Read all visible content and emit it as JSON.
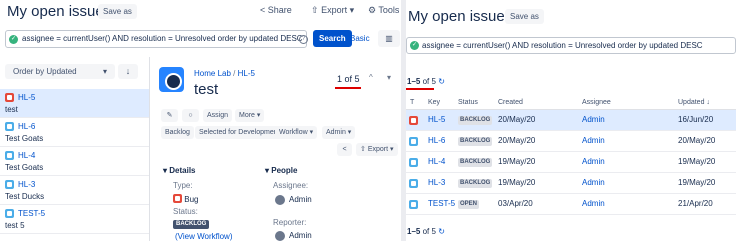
{
  "left": {
    "title": "My open issues",
    "save_as": "Save as",
    "share": "Share",
    "export": "Export",
    "tools": "Tools",
    "jql": "assignee = currentUser() AND resolution = Unresolved order by updated DESC",
    "search": "Search",
    "basic": "Basic",
    "order_by": "Order by Updated",
    "list": [
      {
        "key": "HL-5",
        "summary": "test",
        "type": "bug",
        "selected": true
      },
      {
        "key": "HL-6",
        "summary": "Test Goats",
        "type": "task",
        "selected": false
      },
      {
        "key": "HL-4",
        "summary": "Test Goats",
        "type": "task",
        "selected": false
      },
      {
        "key": "HL-3",
        "summary": "Test Ducks",
        "type": "task",
        "selected": false
      },
      {
        "key": "TEST-5",
        "summary": "test 5",
        "type": "task",
        "selected": false
      }
    ],
    "detail": {
      "breadcrumb_project": "Home Lab",
      "breadcrumb_sep": "/",
      "breadcrumb_key": "HL-5",
      "title": "test",
      "pager": "1 of 5",
      "assign": "Assign",
      "more": "More",
      "workflow_buttons": [
        "Backlog",
        "Selected for Development",
        "Workflow",
        "Admin"
      ],
      "export": "Export",
      "details_heading": "Details",
      "people_heading": "People",
      "type_label": "Type:",
      "type_value": "Bug",
      "status_label": "Status:",
      "status_value": "BACKLOG",
      "view_workflow": "(View Workflow)",
      "assignee_label": "Assignee:",
      "assignee_value": "Admin",
      "reporter_label": "Reporter:",
      "reporter_value": "Admin"
    }
  },
  "right": {
    "title": "My open issues",
    "save_as": "Save as",
    "jql": "assignee = currentUser() AND resolution = Unresolved order by updated DESC",
    "count_range": "1–5",
    "count_of": "of",
    "count_total": "5",
    "columns": [
      "T",
      "Key",
      "Status",
      "Created",
      "Assignee",
      "Updated"
    ],
    "rows": [
      {
        "type": "bug",
        "key": "HL-5",
        "status": "BACKLOG",
        "created": "20/May/20",
        "assignee": "Admin",
        "updated": "16/Jun/20",
        "selected": true
      },
      {
        "type": "task",
        "key": "HL-6",
        "status": "BACKLOG",
        "created": "20/May/20",
        "assignee": "Admin",
        "updated": "20/May/20",
        "selected": false
      },
      {
        "type": "task",
        "key": "HL-4",
        "status": "BACKLOG",
        "created": "19/May/20",
        "assignee": "Admin",
        "updated": "19/May/20",
        "selected": false
      },
      {
        "type": "task",
        "key": "HL-3",
        "status": "BACKLOG",
        "created": "19/May/20",
        "assignee": "Admin",
        "updated": "19/May/20",
        "selected": false
      },
      {
        "type": "task",
        "key": "TEST-5",
        "status": "OPEN",
        "created": "03/Apr/20",
        "assignee": "Admin",
        "updated": "21/Apr/20",
        "selected": false
      }
    ]
  }
}
